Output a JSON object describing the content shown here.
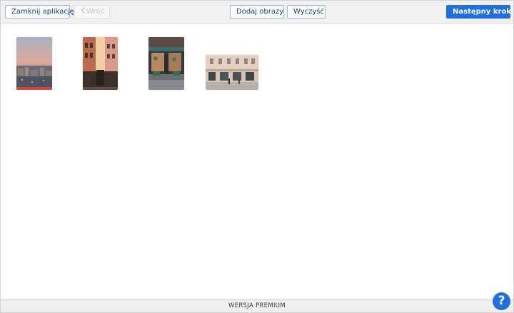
{
  "toolbar": {
    "close_label": "Zamknij aplikację",
    "back_label": "Wróć",
    "add_label": "Dodaj obrazy",
    "clear_label": "Wyczyść",
    "next_label": "Następny krok"
  },
  "images": [
    {
      "name": "city-sunset-photo"
    },
    {
      "name": "building-facade-photo"
    },
    {
      "name": "cafe-storefront-photo"
    },
    {
      "name": "street-building-photo"
    }
  ],
  "footer": {
    "label": "WERSJA PREMIUM"
  },
  "help": {
    "label": "?"
  },
  "colors": {
    "accent": "#1f6fe0",
    "button_border": "#9fb6d6"
  }
}
